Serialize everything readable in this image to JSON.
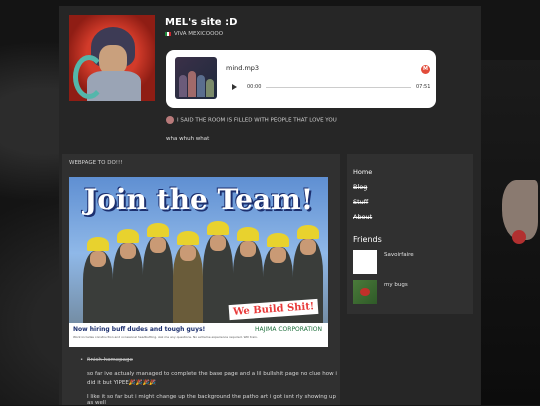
{
  "header": {
    "site_title": "MEL's site :D",
    "subtitle": "VIVA MEXICOOOO",
    "status": "I SAID THE ROOM IS FILLED WITH PEOPLE THAT LOVE YOU",
    "whuh": "wha whuh what"
  },
  "player": {
    "filename": "mind.mp3",
    "time_current": "00:00",
    "time_total": "07:51",
    "badge": "M"
  },
  "main": {
    "heading": "WEBPAGE TO DO!!!",
    "poster": {
      "title": "Join the Team!",
      "slogan": "We Build Shit!",
      "footer_line1": "Now hiring buff dudes and tough guys!",
      "footer_line2": "Work includes construction and occasional headbutting. Ask me any questions. No extreme experience required. Will train.",
      "company": "HAJIMA CORPORATION"
    },
    "todo_item": "finish homepage",
    "paragraph1": "so far ive actualy managed to complete the base page and a lil bullshit page no clue how i did it but YIPEE🎉🎉🎉🎉",
    "paragraph2": "I like it so far but i might change up the background the patho art i got isnt rly showing up as well"
  },
  "sidebar": {
    "nav": [
      "Home",
      "Blog",
      "Stuff",
      "About"
    ],
    "friends_heading": "Friends",
    "friends": [
      {
        "name": "Savoirfaire"
      },
      {
        "name": "my bugs"
      }
    ]
  }
}
